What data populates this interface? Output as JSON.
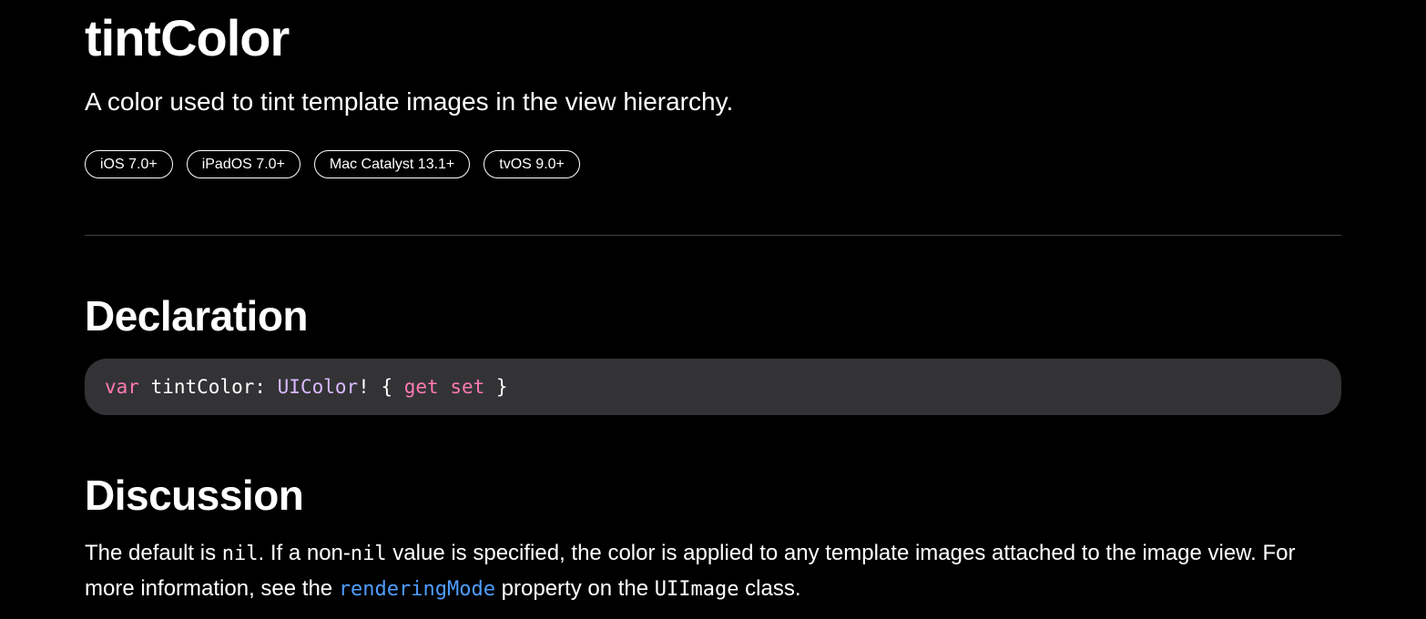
{
  "header": {
    "title": "tintColor",
    "abstract": "A color used to tint template images in the view hierarchy."
  },
  "availability": [
    "iOS 7.0+",
    "iPadOS 7.0+",
    "Mac Catalyst 13.1+",
    "tvOS 9.0+"
  ],
  "declaration": {
    "heading": "Declaration",
    "code": {
      "kw_var": "var",
      "name": " tintColor: ",
      "type": "UIColor",
      "bang_brace": "! { ",
      "kw_get": "get",
      "space": " ",
      "kw_set": "set",
      "close": " }"
    }
  },
  "discussion": {
    "heading": "Discussion",
    "t1": "The default is ",
    "c1": "nil",
    "t2": ". If a non-",
    "c2": "nil",
    "t3": " value is specified, the color is applied to any template images attached to the image view. For more information, see the ",
    "link": "renderingMode",
    "t4": " property on the ",
    "c3": "UIImage",
    "t5": " class."
  },
  "colors": {
    "background": "#000000",
    "keyword": "#ff7ab2",
    "type": "#dabaff",
    "link": "#4f9dff",
    "code_background": "#333336"
  }
}
